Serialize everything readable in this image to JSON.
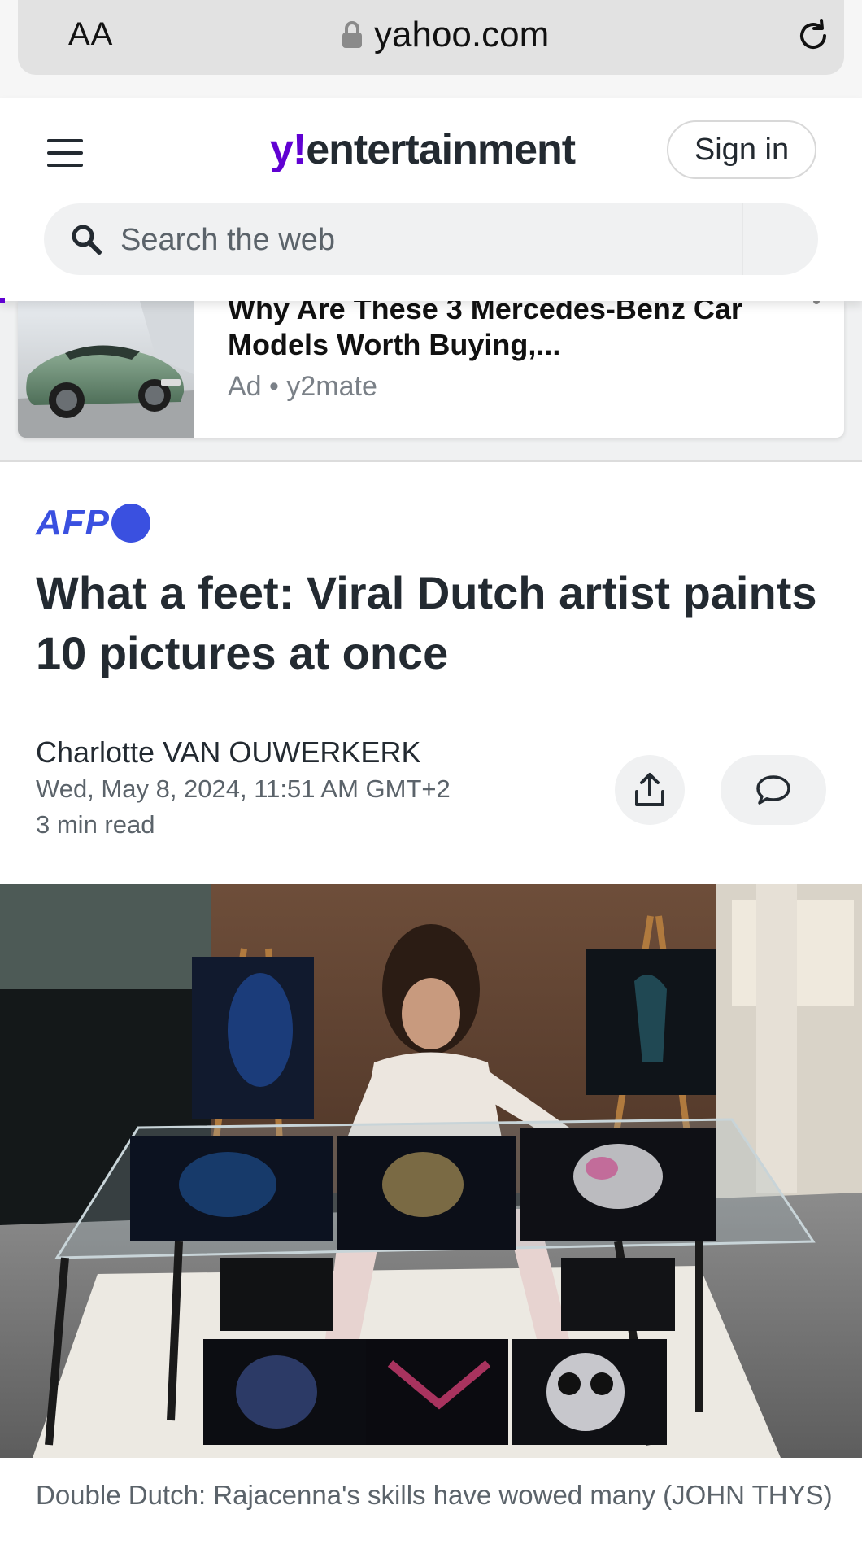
{
  "browser": {
    "text_size_label": "AA",
    "url": "yahoo.com"
  },
  "header": {
    "logo_y": "y!",
    "logo_section": "entertainment",
    "signin_label": "Sign in",
    "search_placeholder": "Search the web"
  },
  "ad": {
    "headline": "Why Are These 3 Mercedes-Benz Car Models Worth Buying,...",
    "meta": "Ad • y2mate"
  },
  "article": {
    "source": "AFP",
    "headline": "What a feet: Viral Dutch artist paints 10 pictures at once",
    "author": "Charlotte VAN OUWERKERK",
    "date": "Wed, May 8, 2024, 11:51 AM GMT+2",
    "read_time": "3 min read",
    "caption": "Double Dutch: Rajacenna's skills have wowed many (JOHN THYS)"
  },
  "icons": {
    "lock": "lock-icon",
    "reload": "reload-icon",
    "menu": "menu-icon",
    "search": "search-icon",
    "share": "share-icon",
    "comment": "comment-icon"
  },
  "colors": {
    "yahoo_purple": "#6001d2",
    "afp_blue": "#3a50e0",
    "text_dark": "#232a31",
    "text_muted": "#5b636a"
  }
}
